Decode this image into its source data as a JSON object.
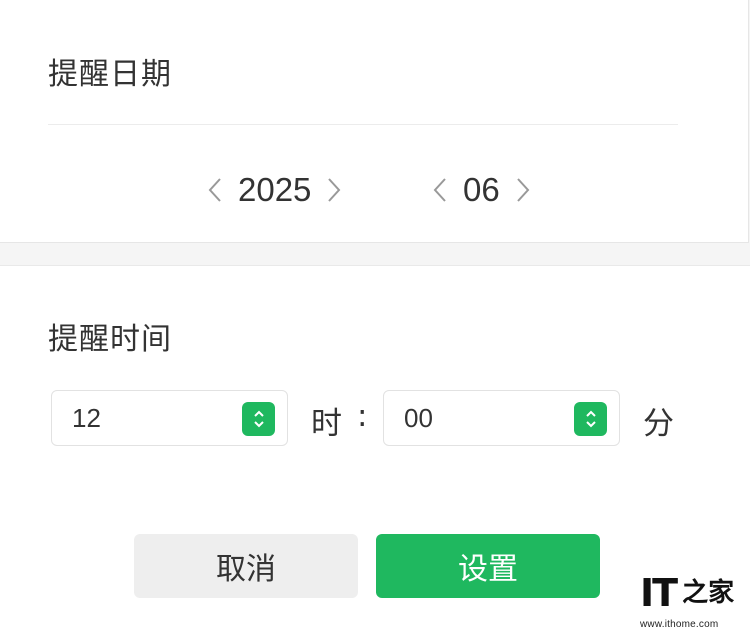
{
  "reminder_date": {
    "title": "提醒日期",
    "year": "2025",
    "month": "06"
  },
  "reminder_time": {
    "title": "提醒时间",
    "hour_value": "12",
    "hour_unit": "时",
    "colon": ":",
    "minute_value": "00",
    "minute_unit": "分"
  },
  "actions": {
    "cancel_label": "取消",
    "set_label": "设置"
  },
  "watermark": {
    "logo_text": "IT",
    "logo_char": "之家",
    "url": "www.ithome.com"
  },
  "colors": {
    "accent": "#1fb85f",
    "cancel_bg": "#eeeeee"
  },
  "icons": {
    "prev": "chevron-left-icon",
    "next": "chevron-right-icon",
    "spinner": "up-down-spinner-icon"
  }
}
